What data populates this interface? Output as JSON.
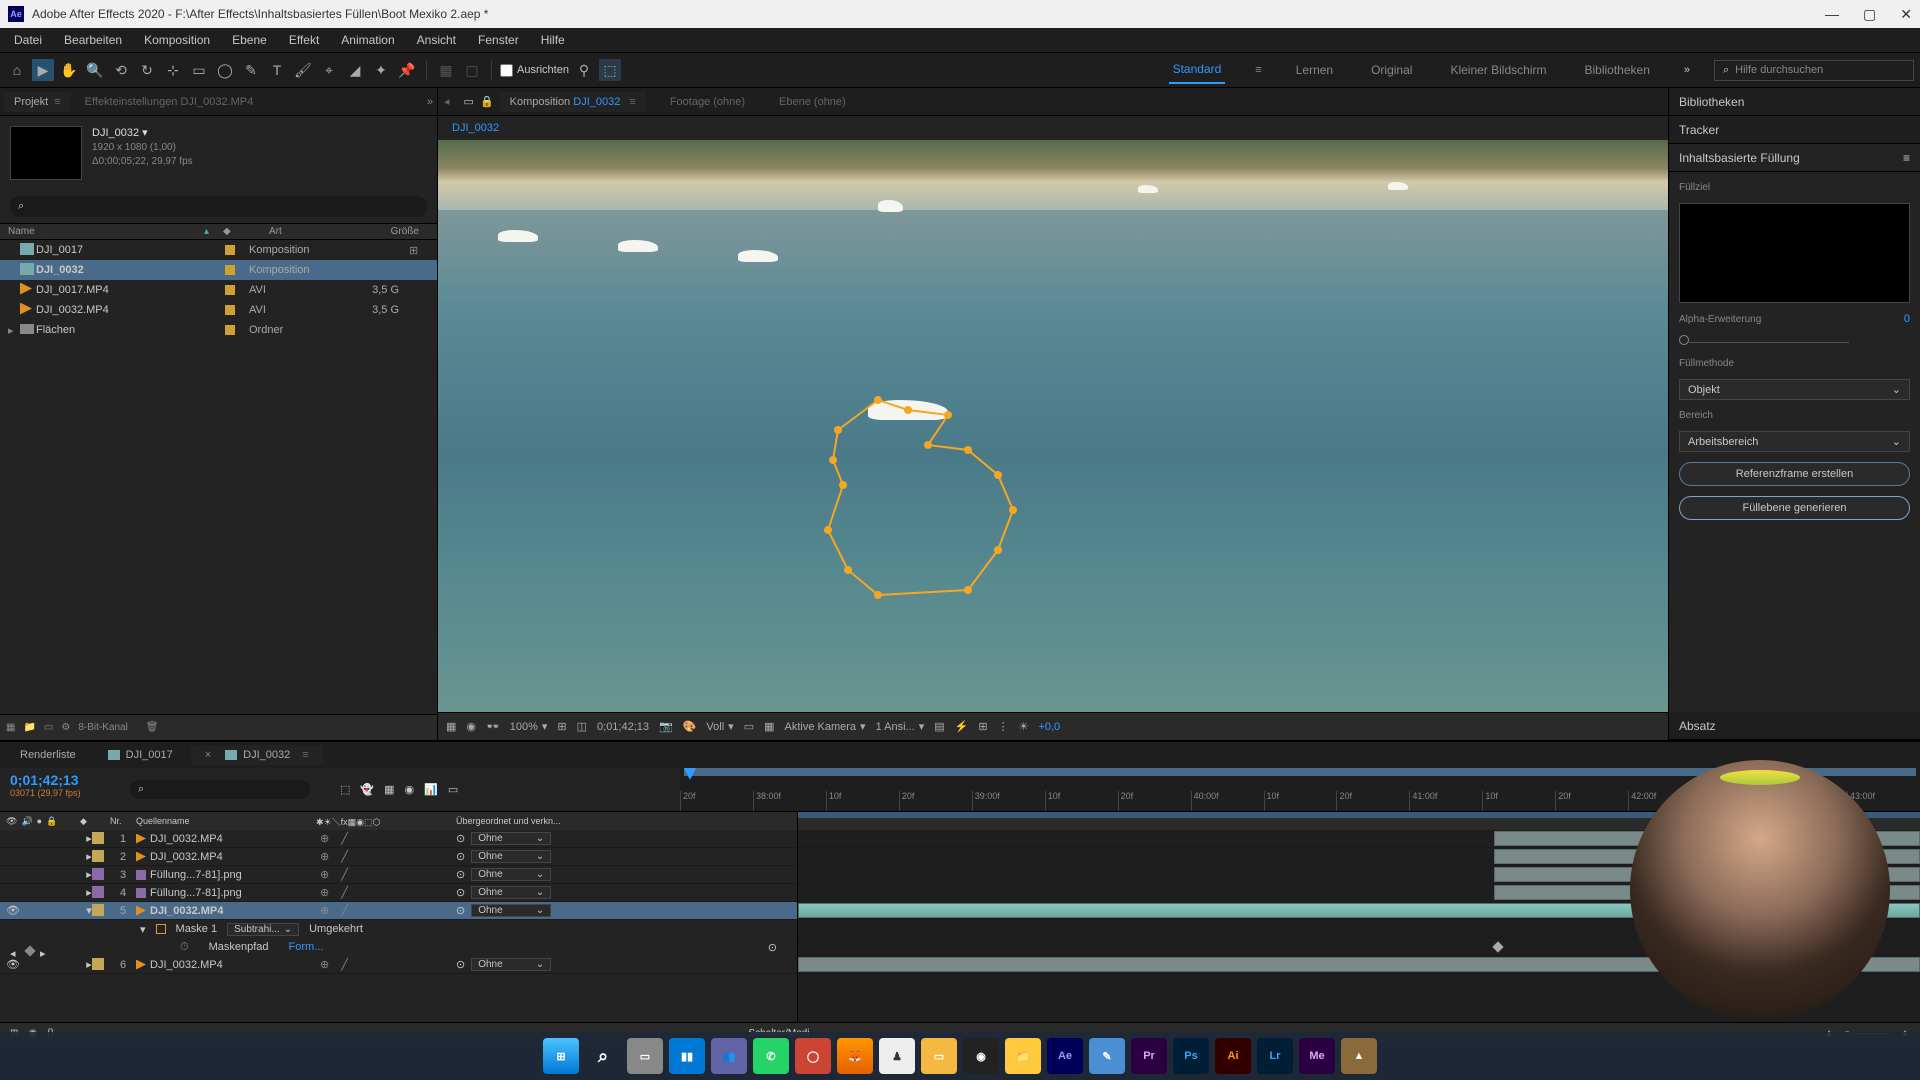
{
  "titlebar": {
    "app_icon": "Ae",
    "title": "Adobe After Effects 2020 - F:\\After Effects\\Inhaltsbasiertes Füllen\\Boot Mexiko 2.aep *"
  },
  "menu": [
    "Datei",
    "Bearbeiten",
    "Komposition",
    "Ebene",
    "Effekt",
    "Animation",
    "Ansicht",
    "Fenster",
    "Hilfe"
  ],
  "toolbar": {
    "snap_label": "Ausrichten",
    "workspaces": [
      "Standard",
      "Lernen",
      "Original",
      "Kleiner Bildschirm",
      "Bibliotheken"
    ],
    "active_workspace": "Standard",
    "search_placeholder": "Hilfe durchsuchen"
  },
  "project": {
    "tab": "Projekt",
    "effects_tab": "Effekteinstellungen DJI_0032.MP4",
    "selected_name": "DJI_0032",
    "meta1": "1920 x 1080 (1,00)",
    "meta2": "Δ0;00;05;22, 29,97 fps",
    "cols": {
      "name": "Name",
      "art": "Art",
      "size": "Größe"
    },
    "rows": [
      {
        "icon": "comp",
        "name": "DJI_0017",
        "art": "Komposition",
        "size": "",
        "label": "#d0a030",
        "linked": true
      },
      {
        "icon": "comp",
        "name": "DJI_0032",
        "art": "Komposition",
        "size": "",
        "label": "#d0a030",
        "selected": true
      },
      {
        "icon": "vid",
        "name": "DJI_0017.MP4",
        "art": "AVI",
        "size": "3,5 G",
        "label": "#d0a030"
      },
      {
        "icon": "vid",
        "name": "DJI_0032.MP4",
        "art": "AVI",
        "size": "3,5 G",
        "label": "#d0a030"
      },
      {
        "icon": "folder",
        "name": "Flächen",
        "art": "Ordner",
        "size": "",
        "label": "#d0a030",
        "twist": true
      }
    ],
    "footer_bits": "8-Bit-Kanal"
  },
  "composition": {
    "tab_label": "Komposition",
    "active_comp": "DJI_0032",
    "footage_tab": "Footage  (ohne)",
    "layer_tab": "Ebene  (ohne)",
    "crumb": "DJI_0032",
    "footer": {
      "zoom": "100%",
      "timecode": "0;01;42;13",
      "res": "Voll",
      "camera": "Aktive Kamera",
      "views": "1 Ansi...",
      "exposure": "+0,0"
    }
  },
  "right": {
    "libs": "Bibliotheken",
    "tracker": "Tracker",
    "caf": {
      "title": "Inhaltsbasierte Füllung",
      "target": "Füllziel",
      "alpha": "Alpha-Erweiterung",
      "alpha_val": "0",
      "method": "Füllmethode",
      "method_val": "Objekt",
      "range": "Bereich",
      "range_val": "Arbeitsbereich",
      "ref_btn": "Referenzframe erstellen",
      "gen_btn": "Füllebene generieren"
    },
    "absatz": "Absatz"
  },
  "timeline": {
    "render_tab": "Renderliste",
    "tabs": [
      "DJI_0017",
      "DJI_0032"
    ],
    "active_tab": "DJI_0032",
    "timecode": "0;01;42;13",
    "frames": "03071 (29,97 fps)",
    "cols": {
      "nr": "Nr.",
      "name": "Quellenname",
      "parent": "Übergeordnet und verkn..."
    },
    "ruler": [
      "20f",
      "38:00f",
      "10f",
      "20f",
      "39:00f",
      "10f",
      "20f",
      "40:00f",
      "10f",
      "20f",
      "41:00f",
      "10f",
      "20f",
      "42:00f",
      "10f",
      "20f",
      "43:00f"
    ],
    "layers": [
      {
        "nr": "1",
        "icon": "vid",
        "name": "DJI_0032.MP4",
        "parent": "Ohne"
      },
      {
        "nr": "2",
        "icon": "vid",
        "name": "DJI_0032.MP4",
        "parent": "Ohne"
      },
      {
        "nr": "3",
        "icon": "img",
        "name": "Füllung...7-81].png",
        "parent": "Ohne"
      },
      {
        "nr": "4",
        "icon": "img",
        "name": "Füllung...7-81].png",
        "parent": "Ohne"
      },
      {
        "nr": "5",
        "icon": "vid",
        "name": "DJI_0032.MP4",
        "parent": "Ohne",
        "selected": true,
        "expanded": true
      },
      {
        "nr": "6",
        "icon": "vid",
        "name": "DJI_0032.MP4",
        "parent": "Ohne"
      }
    ],
    "mask": {
      "name": "Maske 1",
      "mode": "Subtrahi...",
      "invert": "Umgekehrt"
    },
    "mask_prop": {
      "name": "Maskenpfad",
      "value": "Form..."
    },
    "footer_switches": "Schalter/Modi"
  }
}
